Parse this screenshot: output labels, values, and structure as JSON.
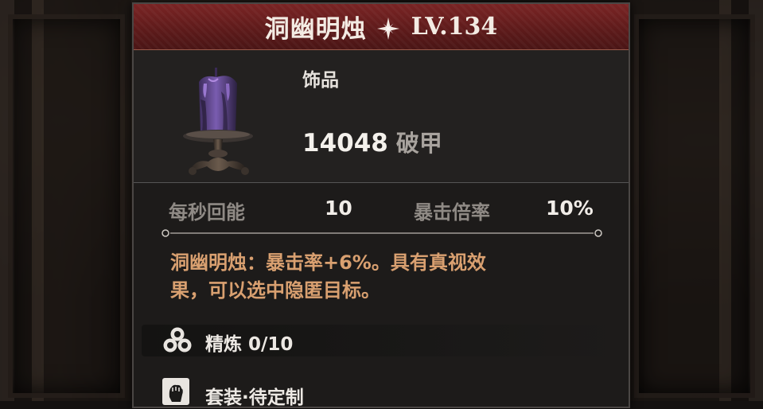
{
  "header": {
    "item_name": "洞幽明烛",
    "level": "LV.134"
  },
  "item": {
    "type": "饰品",
    "main_stat_value": "14048",
    "main_stat_name": "破甲"
  },
  "stats": [
    {
      "label": "每秒回能",
      "value": "10"
    },
    {
      "label": "暴击倍率",
      "value": "10%"
    }
  ],
  "description": {
    "line1": "洞幽明烛：暴击率+6%。具有真视效",
    "line2": "果，可以选中隐匿目标。"
  },
  "refine": {
    "label": "精炼 0/10"
  },
  "set": {
    "label": "套装·待定制"
  },
  "colors": {
    "header_red": "#6a1f1f",
    "desc_orange": "#d9a070",
    "candle_purple": "#6a4a9a"
  },
  "icons": {
    "title_star": "four-point-star-icon",
    "item": "purple-candle-icon",
    "refine": "triple-gem-icon",
    "set": "fist-icon"
  }
}
